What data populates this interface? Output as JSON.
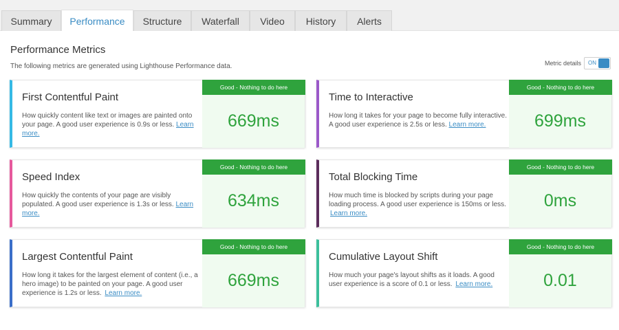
{
  "tabs": [
    {
      "label": "Summary"
    },
    {
      "label": "Performance",
      "active": true
    },
    {
      "label": "Structure"
    },
    {
      "label": "Waterfall"
    },
    {
      "label": "Video"
    },
    {
      "label": "History"
    },
    {
      "label": "Alerts"
    }
  ],
  "section": {
    "title": "Performance Metrics",
    "subtitle": "The following metrics are generated using Lighthouse Performance data."
  },
  "metric_details": {
    "label": "Metric details",
    "state": "ON"
  },
  "colors": {
    "accent": "#3a8cc4",
    "good": "#2fa33d",
    "value_bg": "#f0fbf0",
    "fcp": "#35b9e5",
    "si": "#e6589c",
    "lcp": "#3a6ec9",
    "tti": "#9b59c9",
    "tbt": "#5c2d5c",
    "cls": "#3cbf9c"
  },
  "metrics": [
    {
      "name": "First Contentful Paint",
      "description": "How quickly content like text or images are painted onto your page. A good user experience is 0.9s or less.",
      "learn_more": "Learn more.",
      "badge": "Good - Nothing to do here",
      "value": "669ms"
    },
    {
      "name": "Time to Interactive",
      "description": "How long it takes for your page to become fully interactive. A good user experience is 2.5s or less.",
      "learn_more": "Learn more.",
      "badge": "Good - Nothing to do here",
      "value": "699ms"
    },
    {
      "name": "Speed Index",
      "description": "How quickly the contents of your page are visibly populated. A good user experience is 1.3s or less.",
      "learn_more": "Learn more.",
      "badge": "Good - Nothing to do here",
      "value": "634ms"
    },
    {
      "name": "Total Blocking Time",
      "description": "How much time is blocked by scripts during your page loading process. A good user experience is 150ms or less.",
      "learn_more": "Learn more.",
      "badge": "Good - Nothing to do here",
      "value": "0ms"
    },
    {
      "name": "Largest Contentful Paint",
      "description": "How long it takes for the largest element of content (i.e., a hero image) to be painted on your page. A good user experience is 1.2s or less.",
      "learn_more": "Learn more.",
      "badge": "Good - Nothing to do here",
      "value": "669ms"
    },
    {
      "name": "Cumulative Layout Shift",
      "description": "How much your page's layout shifts as it loads. A good user experience is a score of 0.1 or less.",
      "learn_more": "Learn more.",
      "badge": "Good - Nothing to do here",
      "value": "0.01"
    }
  ]
}
